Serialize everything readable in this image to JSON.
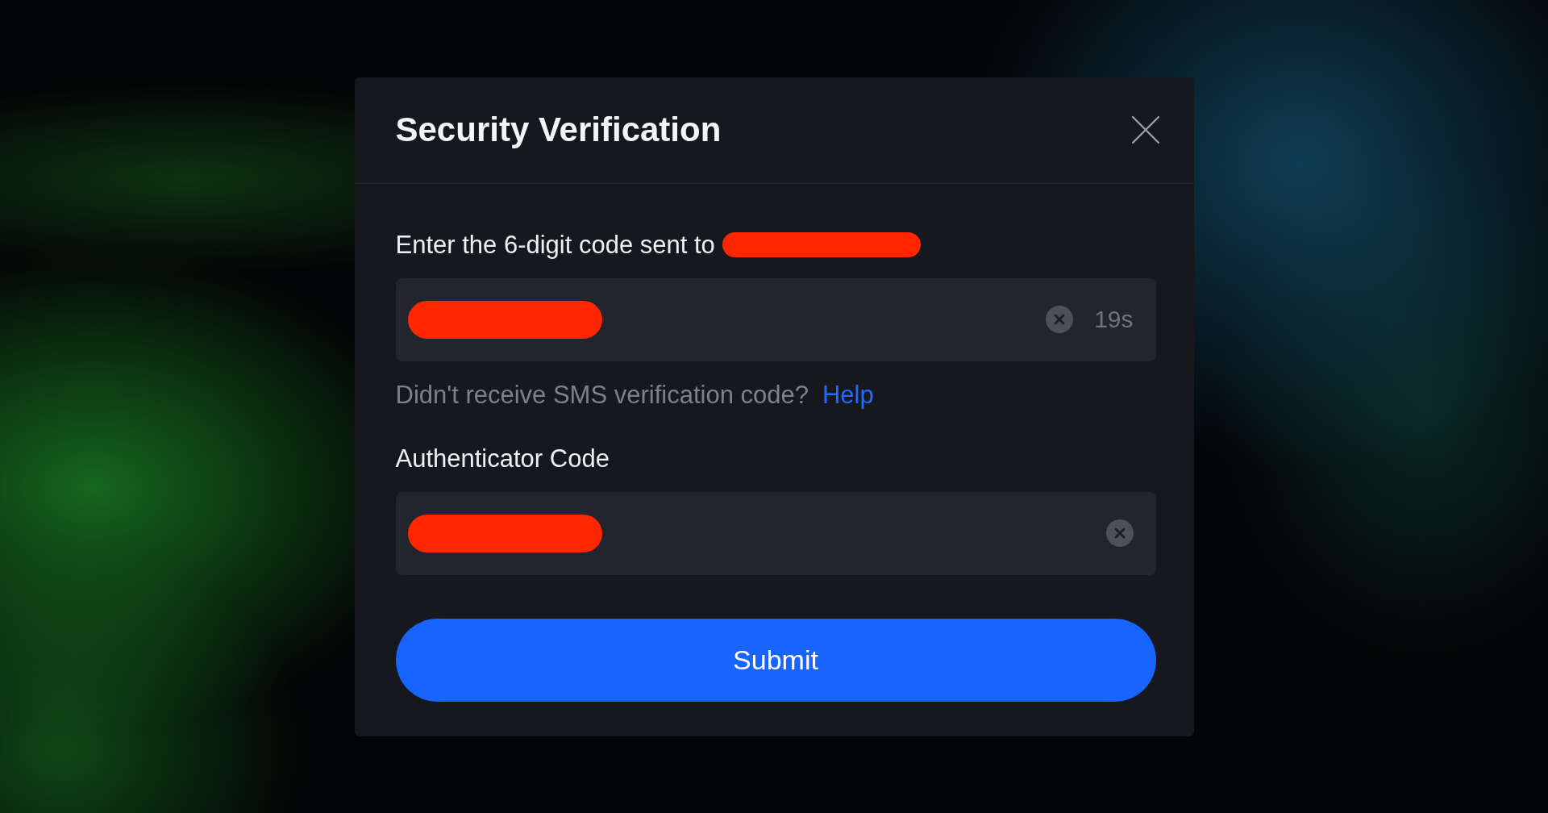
{
  "dialog": {
    "title": "Security Verification"
  },
  "fields": [
    {
      "label": "Enter the 6-digit code sent to",
      "recipient_redacted": true,
      "value_redacted": true,
      "countdown": "19s",
      "help": {
        "text": "Didn't receive SMS verification code?",
        "link": "Help"
      }
    },
    {
      "label": "Authenticator Code",
      "recipient_redacted": false,
      "value_redacted": true
    }
  ],
  "submit_button": {
    "label": "Submit"
  }
}
